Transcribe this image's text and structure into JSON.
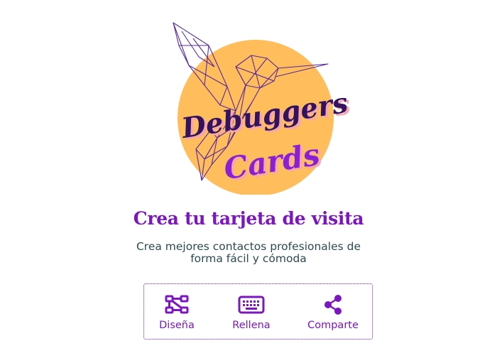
{
  "logo": {
    "line1": "Debuggers",
    "line2": "Cards"
  },
  "hero": {
    "title": "Crea tu tarjeta de visita",
    "subtitle_line1": "Crea mejores contactos profesionales de",
    "subtitle_line2": "forma fácil y cómoda"
  },
  "features": [
    {
      "label": "Diseña",
      "icon": "design-shapes-icon"
    },
    {
      "label": "Rellena",
      "icon": "keyboard-icon"
    },
    {
      "label": "Comparte",
      "icon": "share-icon"
    }
  ],
  "colors": {
    "accent": "#7b16c0",
    "sun": "#ffbd5b",
    "logo_dark": "#34135e",
    "logo_shadow": "#f6a6b0",
    "text": "#2c4a4f"
  }
}
